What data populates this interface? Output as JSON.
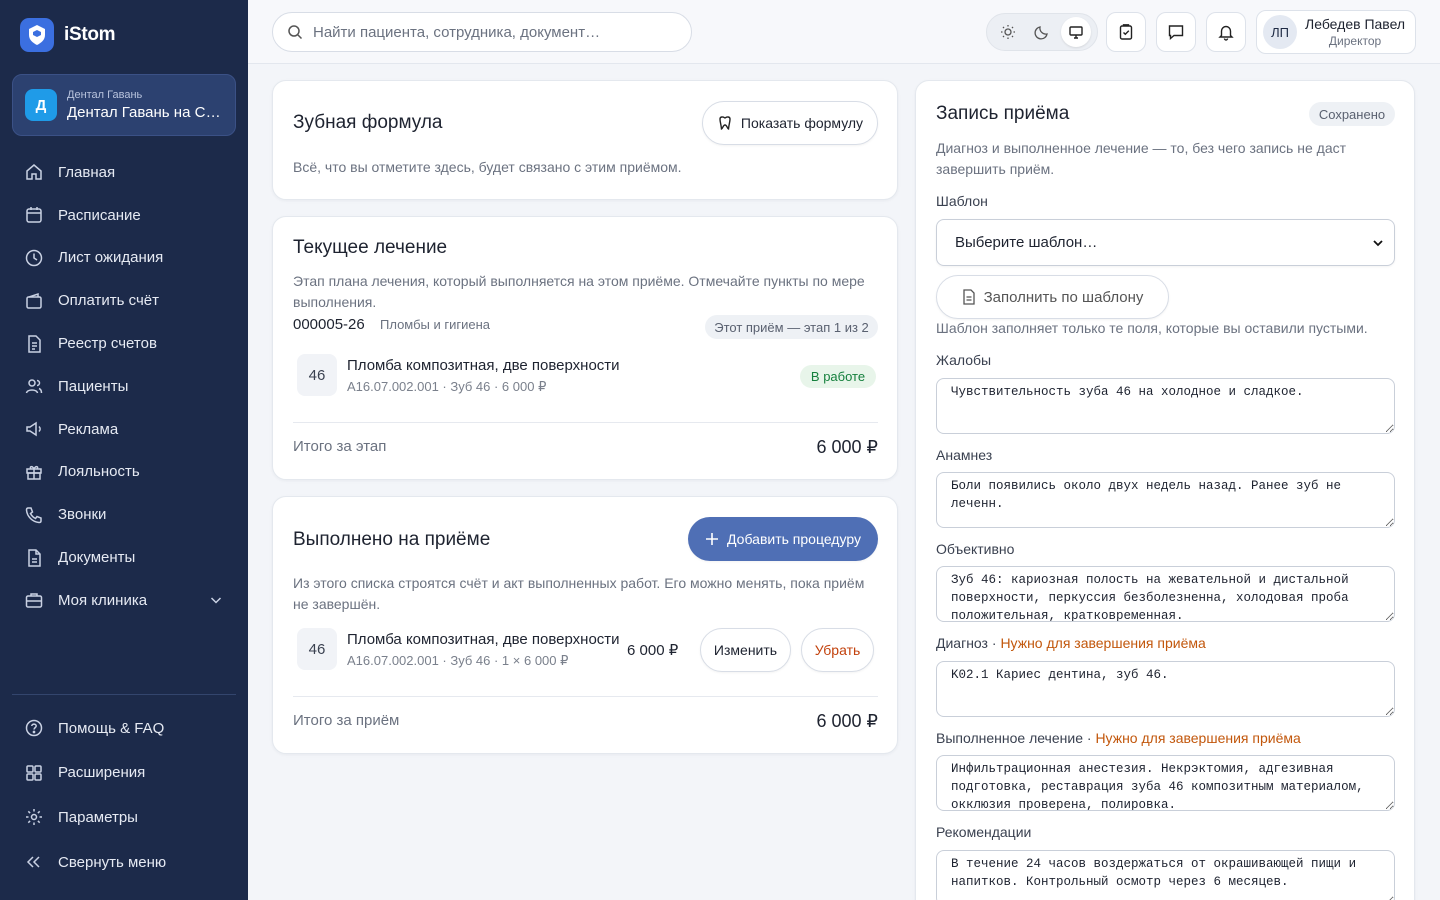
{
  "sidebar": {
    "brand": "iStom",
    "clinic": {
      "avatar": "Д",
      "sub": "Дентал Гавань",
      "name": "Дентал Гавань на Са…"
    },
    "items": [
      {
        "label": "Главная",
        "icon": "home-icon"
      },
      {
        "label": "Расписание",
        "icon": "calendar-icon"
      },
      {
        "label": "Лист ожидания",
        "icon": "clock-icon"
      },
      {
        "label": "Оплатить счёт",
        "icon": "wallet-icon"
      },
      {
        "label": "Реестр счетов",
        "icon": "document-icon"
      },
      {
        "label": "Пациенты",
        "icon": "users-icon"
      },
      {
        "label": "Реклама",
        "icon": "megaphone-icon"
      },
      {
        "label": "Лояльность",
        "icon": "gift-icon"
      },
      {
        "label": "Звонки",
        "icon": "phone-icon"
      },
      {
        "label": "Документы",
        "icon": "file-icon"
      },
      {
        "label": "Моя клиника",
        "icon": "briefcase-icon"
      }
    ],
    "bottom": [
      {
        "label": "Помощь & FAQ",
        "icon": "help-icon"
      },
      {
        "label": "Расширения",
        "icon": "puzzle-icon"
      },
      {
        "label": "Параметры",
        "icon": "gear-icon"
      },
      {
        "label": "Свернуть меню",
        "icon": "collapse-icon"
      }
    ]
  },
  "topbar": {
    "search_placeholder": "Найти пациента, сотрудника, документ…",
    "user": {
      "initials": "ЛП",
      "name": "Лебедев Павел",
      "role": "Директор"
    }
  },
  "dental_formula": {
    "title": "Зубная формула",
    "show_button": "Показать формулу",
    "description": "Всё, что вы отметите здесь, будет связано с этим приёмом."
  },
  "current_treatment": {
    "title": "Текущее лечение",
    "description": "Этап плана лечения, который выполняется на этом приёме. Отмечайте пункты по мере выполнения.",
    "plan_number": "000005-26",
    "plan_name": "Пломбы и гигиена",
    "stage_badge": "Этот приём — этап 1 из 2",
    "item": {
      "tooth": "46",
      "name": "Пломба композитная, две поверхности",
      "meta": "A16.07.002.001 · Зуб 46 · 6 000 ₽",
      "status": "В работе"
    },
    "total_label": "Итого за этап",
    "total_value": "6 000 ₽"
  },
  "performed": {
    "title": "Выполнено на приёме",
    "add_button": "Добавить процедуру",
    "description": "Из этого списка строятся счёт и акт выполненных работ. Его можно менять, пока приём не завершён.",
    "item": {
      "tooth": "46",
      "name": "Пломба композитная, две поверхности",
      "meta": "A16.07.002.001 · Зуб 46 · 1 × 6 000 ₽",
      "price": "6 000 ₽",
      "edit": "Изменить",
      "remove": "Убрать"
    },
    "total_label": "Итого за приём",
    "total_value": "6 000 ₽"
  },
  "record": {
    "title": "Запись приёма",
    "saved_badge": "Сохранено",
    "description": "Диагноз и выполненное лечение — то, без чего запись не даст завершить приём.",
    "template_label": "Шаблон",
    "template_placeholder": "Выберите шаблон…",
    "fill_button": "Заполнить по шаблону",
    "fill_hint": "Шаблон заполняет только те поля, которые вы оставили пустыми.",
    "required_note": "Нужно для завершения приёма",
    "fields": {
      "complaints": {
        "label": "Жалобы",
        "value": "Чувствительность зуба 46 на холодное и сладкое."
      },
      "anamnesis": {
        "label": "Анамнез",
        "value": "Боли появились около двух недель назад. Ранее зуб не леченн."
      },
      "objective": {
        "label": "Объективно",
        "value": "Зуб 46: кариозная полость на жевательной и дистальной поверхности, перкуссия безболезненна, холодовая проба положительная, кратковременная."
      },
      "diagnosis": {
        "label": "Диагноз",
        "value": "K02.1 Кариес дентина, зуб 46."
      },
      "treatment": {
        "label": "Выполненное лечение",
        "value": "Инфильтрационная анестезия. Некрэктомия, адгезивная подготовка, реставрация зуба 46 композитным материалом, окклюзия проверена, полировка."
      },
      "recommendations": {
        "label": "Рекомендации",
        "value": "В течение 24 часов воздержаться от окрашивающей пищи и напитков. Контрольный осмотр через 6 месяцев."
      }
    }
  },
  "colors": {
    "sidebar_bg": "#1c2a4a",
    "accent": "#4f6fb5",
    "status_green": "#15803d",
    "required": "#c2570c",
    "danger": "#c2410c"
  }
}
